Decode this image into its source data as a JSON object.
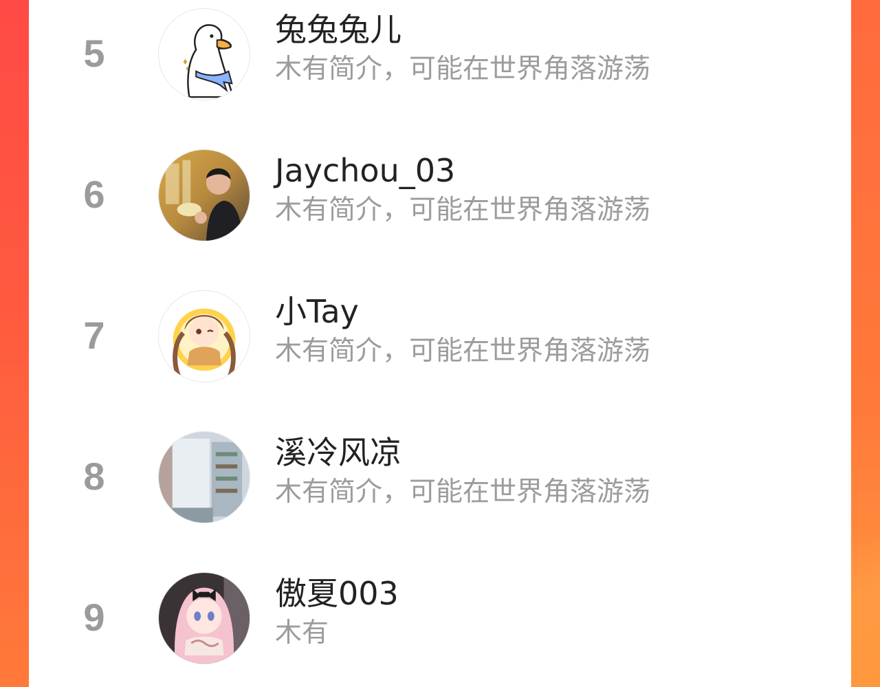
{
  "users": [
    {
      "rank": "5",
      "name": "兔兔兔儿",
      "bio": "木有简介，可能在世界角落游荡",
      "avatar_icon": "duck-avatar-icon"
    },
    {
      "rank": "6",
      "name": "Jaychou_03",
      "bio": "木有简介，可能在世界角落游荡",
      "avatar_icon": "photo-avatar-icon"
    },
    {
      "rank": "7",
      "name": "小Tay",
      "bio": "木有简介，可能在世界角落游荡",
      "avatar_icon": "anime-girl-avatar-icon"
    },
    {
      "rank": "8",
      "name": "溪冷风凉",
      "bio": "木有简介，可能在世界角落游荡",
      "avatar_icon": "room-photo-avatar-icon"
    },
    {
      "rank": "9",
      "name": "傲夏003",
      "bio": "木有",
      "avatar_icon": "anime-pink-hair-avatar-icon"
    }
  ],
  "colors": {
    "background_gradient_top": "#ff4a45",
    "background_gradient_bottom": "#ff7a3a",
    "rank_color": "#9b9b9b",
    "name_color": "#222222",
    "bio_color": "#9c9c9c"
  }
}
